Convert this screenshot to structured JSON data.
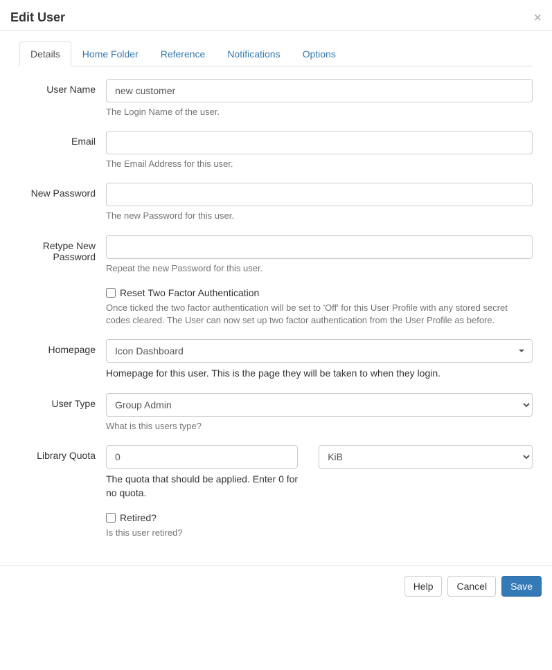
{
  "modal": {
    "title": "Edit User",
    "close_glyph": "×"
  },
  "tabs": [
    {
      "label": "Details"
    },
    {
      "label": "Home Folder"
    },
    {
      "label": "Reference"
    },
    {
      "label": "Notifications"
    },
    {
      "label": "Options"
    }
  ],
  "fields": {
    "username": {
      "label": "User Name",
      "value": "new customer",
      "help": "The Login Name of the user."
    },
    "email": {
      "label": "Email",
      "value": "",
      "help": "The Email Address for this user."
    },
    "new_password": {
      "label": "New Password",
      "value": "",
      "help": "The new Password for this user."
    },
    "retype_password": {
      "label": "Retype New Password",
      "value": "",
      "help": "Repeat the new Password for this user."
    },
    "reset_2fa": {
      "label": "Reset Two Factor Authentication",
      "help": "Once ticked the two factor authentication will be set to 'Off' for this User Profile with any stored secret codes cleared. The User can now set up two factor authentication from the User Profile as before."
    },
    "homepage": {
      "label": "Homepage",
      "value": "Icon Dashboard",
      "help": "Homepage for this user. This is the page they will be taken to when they login."
    },
    "user_type": {
      "label": "User Type",
      "value": "Group Admin",
      "help": "What is this users type?"
    },
    "library_quota": {
      "label": "Library Quota",
      "value": "0",
      "unit": "KiB",
      "help": "The quota that should be applied. Enter 0 for no quota."
    },
    "retired": {
      "label": "Retired?",
      "help": "Is this user retired?"
    }
  },
  "footer": {
    "help": "Help",
    "cancel": "Cancel",
    "save": "Save"
  }
}
